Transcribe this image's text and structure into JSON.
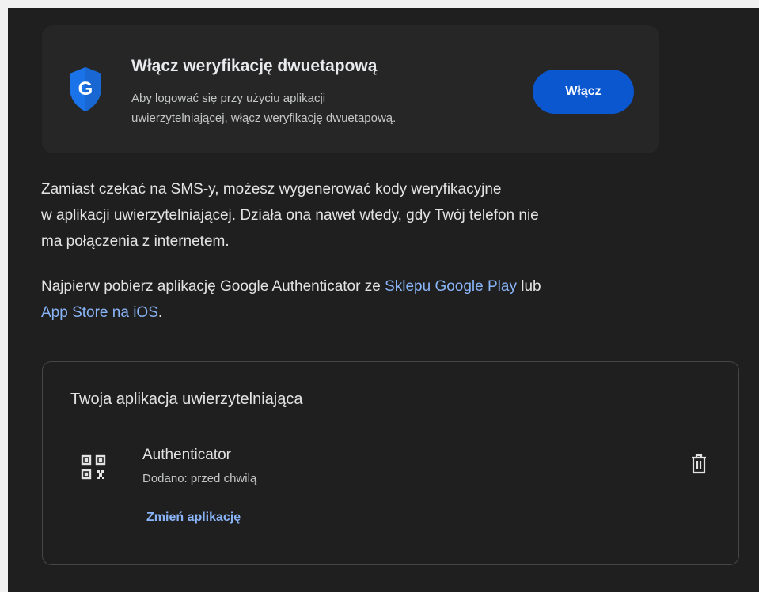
{
  "promo": {
    "title": "Włącz weryfikację dwuetapową",
    "desc_line1": "Aby logować się przy użyciu aplikacji",
    "desc_line2": "uwierzytelniającej, włącz weryfikację dwuetapową.",
    "button_label": "Włącz",
    "shield_letter": "G",
    "icon": "shield-icon"
  },
  "intro": {
    "line1": "Zamiast czekać na SMS-y, możesz wygenerować kody weryfikacyjne",
    "line2": "w aplikacji uwierzytelniającej. Działa ona nawet wtedy, gdy Twój telefon nie",
    "line3": "ma połączenia z internetem."
  },
  "download": {
    "text_before": "Najpierw pobierz aplikację Google Authenticator ze ",
    "play_link": "Sklepu Google Play",
    "text_mid": " lub",
    "ios_link": "App Store na iOS",
    "text_end": "."
  },
  "authenticator_card": {
    "title": "Twoja aplikacja uwierzytelniająca",
    "app_name": "Authenticator",
    "added": "Dodano: przed chwilą",
    "change_link": "Zmień aplikację",
    "icons": [
      "qr-code-icon",
      "trash-icon"
    ]
  },
  "colors": {
    "background": "#1f1f1f",
    "accent_button": "#0b57d0",
    "link": "#8ab4f8",
    "shield": "#1a73e8"
  }
}
